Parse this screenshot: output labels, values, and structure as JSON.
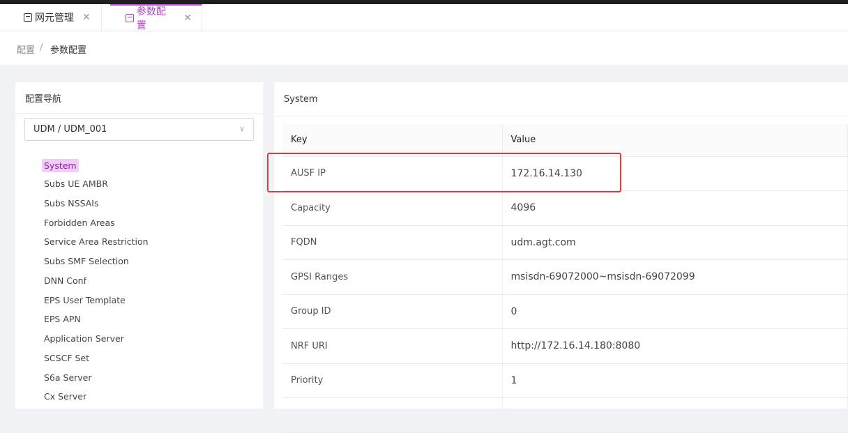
{
  "tabs": [
    {
      "label": "网元管理",
      "close": "✕"
    },
    {
      "label": "参数配置",
      "close": "✕"
    }
  ],
  "breadcrumb": {
    "root": "配置",
    "separator": "/",
    "current": "参数配置"
  },
  "left_panel": {
    "title": "配置导航",
    "select_value": "UDM / UDM_001",
    "items": [
      "System",
      "Subs UE AMBR",
      "Subs NSSAIs",
      "Forbidden Areas",
      "Service Area Restriction",
      "Subs SMF Selection",
      "DNN Conf",
      "EPS User Template",
      "EPS APN",
      "Application Server",
      "SCSCF Set",
      "S6a Server",
      "Cx Server"
    ]
  },
  "right_panel": {
    "title": "System",
    "columns": [
      "Key",
      "Value"
    ],
    "rows": [
      [
        "AUSF IP",
        "172.16.14.130"
      ],
      [
        "Capacity",
        "4096"
      ],
      [
        "FQDN",
        "udm.agt.com"
      ],
      [
        "GPSI Ranges",
        "msisdn-69072000~msisdn-69072099"
      ],
      [
        "Group ID",
        "0"
      ],
      [
        "NRF URI",
        "http://172.16.14.180:8080"
      ],
      [
        "Priority",
        "1"
      ]
    ]
  },
  "colors": {
    "accent": "#b042c9",
    "active_bg": "#f1cdf7",
    "highlight": "#e23b3b"
  }
}
